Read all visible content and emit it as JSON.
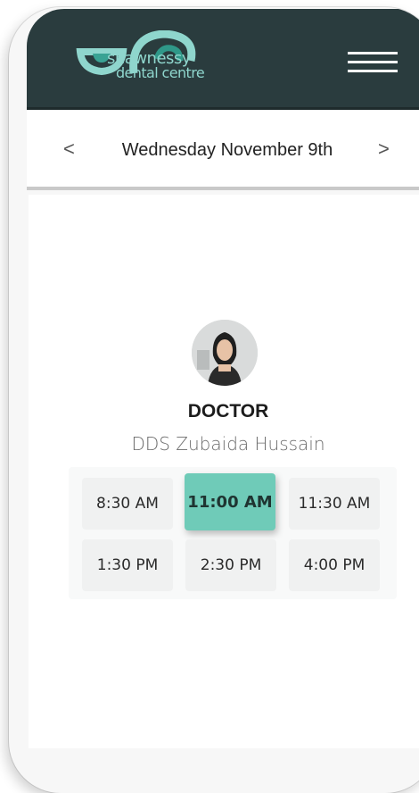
{
  "header": {
    "logo_line1": "shawnessy",
    "logo_line2": "dental centre",
    "brand_colors": {
      "dark": "#2a3c3e",
      "teal": "#8fd6cd",
      "accent": "#6fcbb8"
    }
  },
  "datebar": {
    "prev_icon": "chevron-left-icon",
    "prev_glyph": "<",
    "date": "Wednesday November 9th",
    "next_icon": "chevron-right-icon",
    "next_glyph": ">"
  },
  "doctor": {
    "role": "DOCTOR",
    "name": "DDS Zubaida Hussain"
  },
  "time_slots": [
    {
      "label": "8:30 AM",
      "selected": false
    },
    {
      "label": "11:00 AM",
      "selected": true
    },
    {
      "label": "11:30 AM",
      "selected": false
    },
    {
      "label": "1:30 PM",
      "selected": false
    },
    {
      "label": "2:30 PM",
      "selected": false
    },
    {
      "label": "4:00 PM",
      "selected": false
    }
  ]
}
